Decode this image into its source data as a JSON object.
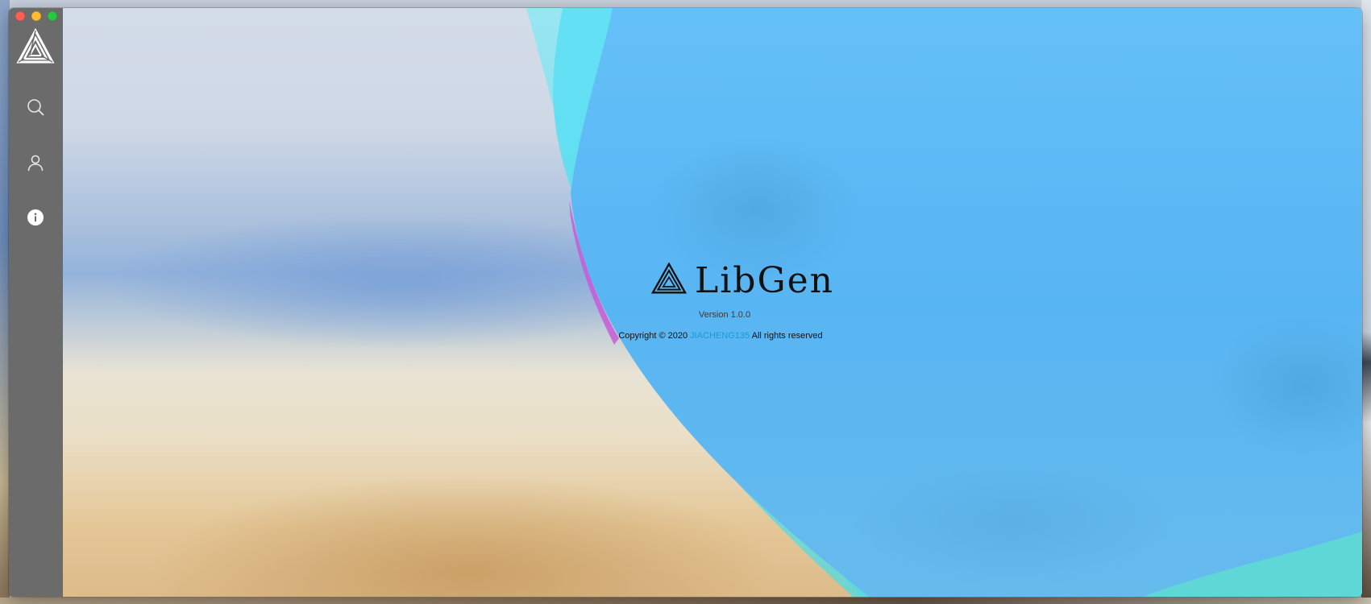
{
  "window": {
    "controls": [
      "close",
      "minimize",
      "zoom"
    ]
  },
  "sidebar": {
    "logo_icon": "impossible-triangle-logo",
    "items": [
      {
        "id": "search",
        "icon": "search-icon"
      },
      {
        "id": "account",
        "icon": "user-icon"
      },
      {
        "id": "about",
        "icon": "info-icon",
        "active": true
      }
    ]
  },
  "about": {
    "app_name": "LibGen",
    "version": "Version 1.0.0",
    "copyright_prefix": "Copyright © 2020",
    "author": "JIACHENG135",
    "copyright_suffix": "All rights reserved"
  },
  "colors": {
    "sidebar": "#6b6b6b",
    "wave_blue": "#5bb7f4",
    "wave_cyan": "#5ee0f2",
    "wave_magenta": "#c85bd8",
    "author_link": "#1a9ad6"
  }
}
